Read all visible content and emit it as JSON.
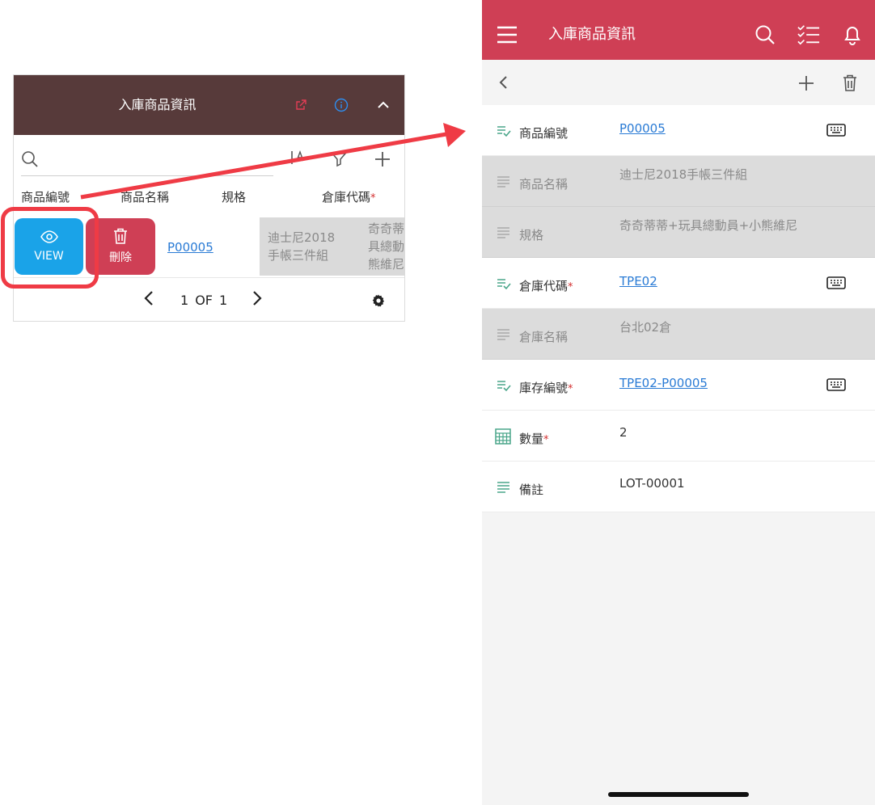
{
  "left_panel": {
    "title": "入庫商品資訊",
    "columns": [
      "商品編號",
      "商品名稱",
      "規格",
      "倉庫代碼"
    ],
    "row": {
      "view_label": "VIEW",
      "delete_label": "刪除",
      "code": "P00005",
      "name_line1": "迪士尼2018",
      "name_line2": "手帳三件組",
      "spec_line1": "奇奇蒂",
      "spec_line2": "具總動",
      "spec_line3": "熊維尼"
    },
    "pager": {
      "current": "1",
      "of_label": "OF",
      "total": "1"
    }
  },
  "right_panel": {
    "title": "入庫商品資訊",
    "fields": [
      {
        "label": "商品編號",
        "value": "P00005",
        "required": false
      },
      {
        "label": "商品名稱",
        "value": "迪士尼2018手帳三件組",
        "required": false
      },
      {
        "label": "規格",
        "value": "奇奇蒂蒂+玩具總動員+小熊維尼",
        "required": false
      },
      {
        "label": "倉庫代碼",
        "value": "TPE02",
        "required": true
      },
      {
        "label": "倉庫名稱",
        "value": "台北02倉",
        "required": false
      },
      {
        "label": "庫存編號",
        "value": "TPE02-P00005",
        "required": true
      },
      {
        "label": "數量",
        "value": "2",
        "required": true
      },
      {
        "label": "備註",
        "value": "LOT-00001",
        "required": false
      }
    ],
    "required_mark": "*"
  },
  "colors": {
    "left_header": "#573a3a",
    "app_bar": "#cf3f55",
    "view_button": "#1aa3e8",
    "delete_button": "#cf3f55",
    "link": "#2a7bd5",
    "highlight": "#ef3b45"
  }
}
